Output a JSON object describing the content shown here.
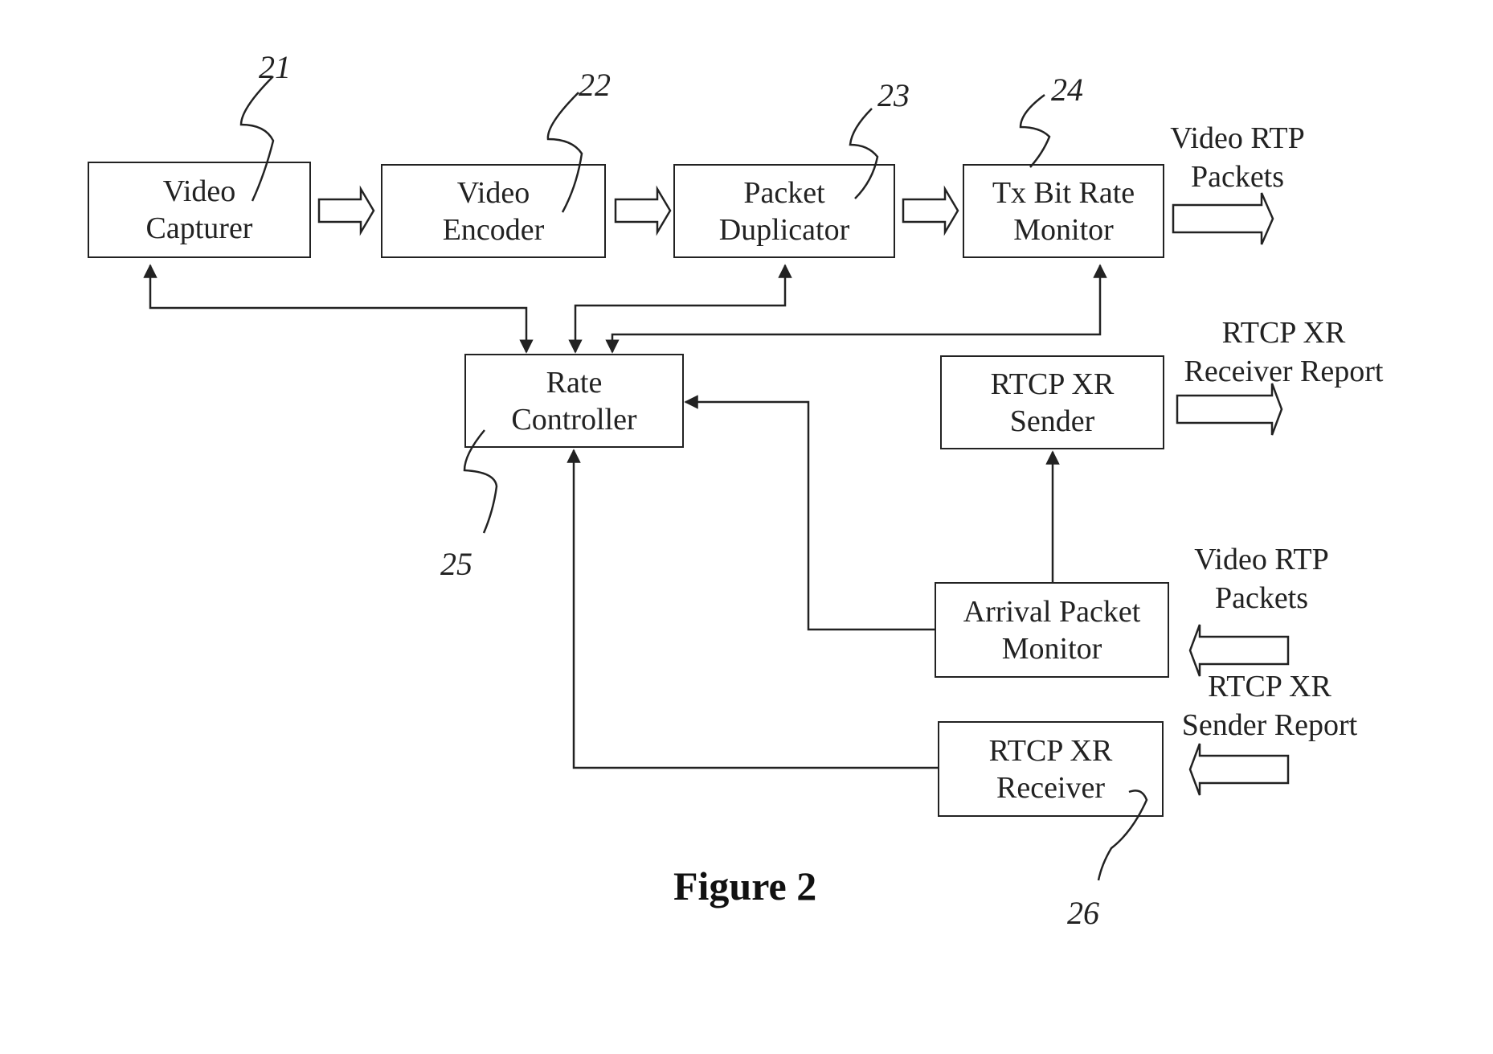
{
  "figure_title": "Figure 2",
  "blocks": [
    {
      "id": "21",
      "lines": [
        "Video",
        "Capturer"
      ]
    },
    {
      "id": "22",
      "lines": [
        "Video",
        "Encoder"
      ]
    },
    {
      "id": "23",
      "lines": [
        "Packet",
        "Duplicator"
      ]
    },
    {
      "id": "24",
      "lines": [
        "Tx Bit Rate",
        "Monitor"
      ]
    },
    {
      "id": "25",
      "lines": [
        "Rate",
        "Controller"
      ]
    },
    {
      "id": "sender",
      "lines": [
        "RTCP XR",
        "Sender"
      ]
    },
    {
      "id": "arrival",
      "lines": [
        "Arrival Packet",
        "Monitor"
      ]
    },
    {
      "id": "26",
      "lines": [
        "RTCP XR",
        "Receiver"
      ]
    }
  ],
  "labels": {
    "video_rtp_out": [
      "Video RTP",
      "Packets"
    ],
    "rtcp_receiver_report": [
      "RTCP XR",
      "Receiver Report"
    ],
    "video_rtp_in": [
      "Video RTP",
      "Packets"
    ],
    "rtcp_sender_report": [
      "RTCP XR",
      "Sender Report"
    ]
  },
  "reference_numerals": [
    "21",
    "22",
    "23",
    "24",
    "25",
    "26"
  ]
}
